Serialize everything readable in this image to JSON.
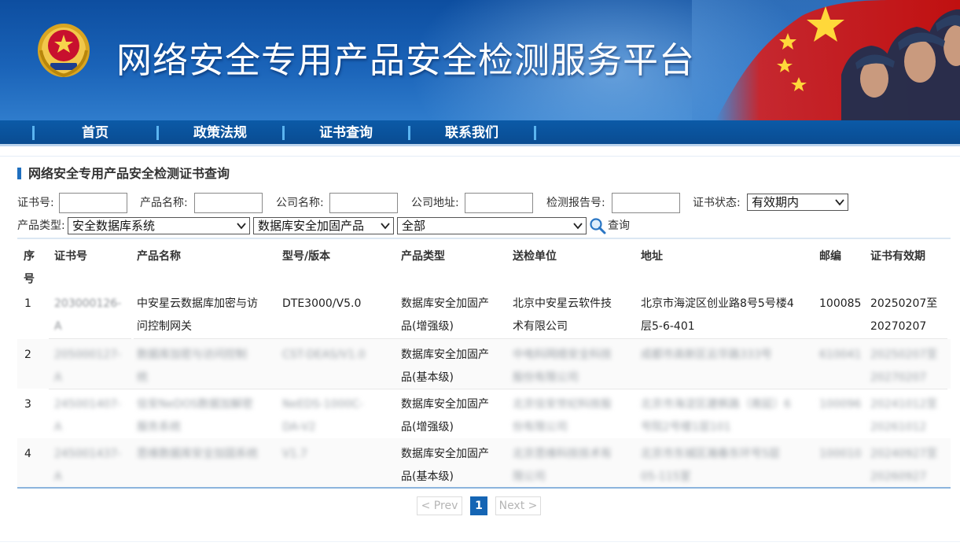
{
  "header": {
    "site_title": "网络安全专用产品安全检测服务平台",
    "logo_icon": "police-emblem-icon",
    "banner_art": "flag-and-police-officers-image"
  },
  "nav": {
    "items": [
      {
        "label": "首页"
      },
      {
        "label": "政策法规"
      },
      {
        "label": "证书查询"
      },
      {
        "label": "联系我们"
      }
    ]
  },
  "section": {
    "title": "网络安全专用产品安全检测证书查询"
  },
  "filters": {
    "cert_no_label": "证书号:",
    "product_name_label": "产品名称:",
    "company_name_label": "公司名称:",
    "company_address_label": "公司地址:",
    "report_no_label": "检测报告号:",
    "cert_status_label": "证书状态:",
    "cert_status_value": "有效期内",
    "product_type_label": "产品类型:",
    "product_type_value": "安全数据库系统",
    "product_subtype_value": "数据库安全加固产品",
    "product_level_value": "全部",
    "query_label": "查询",
    "query_icon": "magnifier-icon"
  },
  "table": {
    "headers": [
      "序号",
      "证书号",
      "产品名称",
      "型号/版本",
      "产品类型",
      "送检单位",
      "地址",
      "邮编",
      "证书有效期"
    ],
    "rows": [
      {
        "index": "1",
        "cert_no_a": "203000126-",
        "cert_no_b": "A",
        "product_a": "中安星云数据库加密与访",
        "product_b": "问控制网关",
        "model": "DTE3000/V5.0",
        "type_a": "数据库安全加固产",
        "type_b": "品(增强级)",
        "org_a": "北京中安星云软件技",
        "org_b": "术有限公司",
        "addr_a": "北京市海淀区创业路8号5号楼4",
        "addr_b": "层5-6-401",
        "zip": "100085",
        "valid_a": "20250207至",
        "valid_b": "20270207"
      },
      {
        "index": "2",
        "cert_no_a": "205000127-",
        "cert_no_b": "A",
        "product_a": "数据库加密与访问控制",
        "product_b": "统",
        "model": "CST-DEAS/V1.0",
        "type_a": "数据库安全加固产",
        "type_b": "品(基本级)",
        "org_a": "中电科网络安全科技",
        "org_b": "股份有限公司",
        "addr_a": "成都市高新区云华路333号",
        "addr_b": "",
        "zip": "610041",
        "valid_a": "20250207至",
        "valid_b": "20270207"
      },
      {
        "index": "3",
        "cert_no_a": "245001407-",
        "cert_no_b": "A",
        "product_a": "信安NeDOS数据加解密",
        "product_b": "服务系统",
        "model": "NeEDS-1000C-",
        "model_b": "DA-V2",
        "type_a": "数据库安全加固产",
        "type_b": "品(增强级)",
        "org_a": "北京信安世纪科技股",
        "org_b": "份有限公司",
        "addr_a": "北京市海淀区建枫路（南延）6",
        "addr_b": "号院2号楼1层101",
        "zip": "100096",
        "valid_a": "20241012至",
        "valid_b": "20261012"
      },
      {
        "index": "4",
        "cert_no_a": "245001437-",
        "cert_no_b": "A",
        "product_a": "思维数据库安全加固系统",
        "product_b": "",
        "model": "V1.7",
        "type_a": "数据库安全加固产",
        "type_b": "品(基本级)",
        "org_a": "北京思维科技技术有",
        "org_b": "限公司",
        "addr_a": "北京市东城区瀚春东环号5层",
        "addr_b": "05-115室",
        "zip": "100010",
        "valid_a": "20240927至",
        "valid_b": "20260927"
      }
    ]
  },
  "pagination": {
    "prev": "< Prev",
    "current": "1",
    "next": "Next >"
  },
  "colors": {
    "banner": "#1a63b8",
    "nav": "#0a4c92",
    "accent": "#1565b4"
  }
}
